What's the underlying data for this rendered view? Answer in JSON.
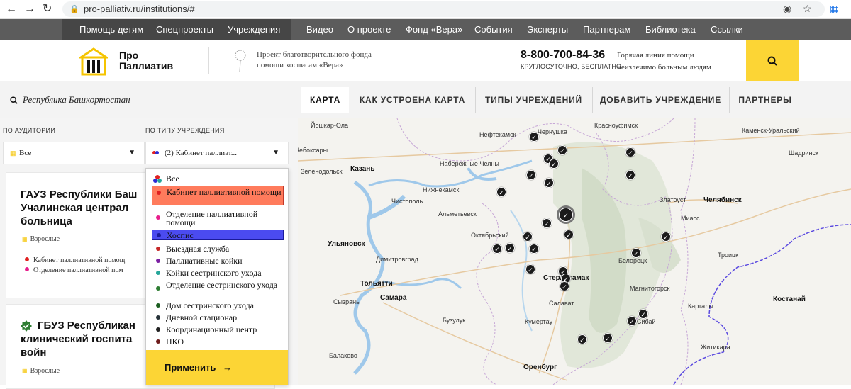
{
  "browser": {
    "url": "pro-palliativ.ru/institutions/#"
  },
  "topmenu": {
    "items": [
      "Помощь детям",
      "Спецпроекты",
      "Учреждения",
      "Видео",
      "О проекте",
      "Фонд «Вера»",
      "События",
      "Эксперты",
      "Партнерам",
      "Библиотека",
      "Ссылки"
    ]
  },
  "header": {
    "logo_line1": "Про",
    "logo_line2": "Паллиатив",
    "fund_line1": "Проект благотворительного фонда",
    "fund_line2": "помощи хосписам «Вера»",
    "phone": "8-800-700-84-36",
    "phone_sub": "КРУГЛОСУТОЧНО, БЕСПЛАТНО",
    "hotline_line1": "Горячая линия помощи",
    "hotline_line2": "неизлечимо больным людям"
  },
  "tabbar": {
    "region": "Республика Башкортостан",
    "tabs": [
      "КАРТА",
      "КАК УСТРОЕНА КАРТА",
      "ТИПЫ УЧРЕЖДЕНИЙ",
      "ДОБАВИТЬ УЧРЕЖДЕНИЕ",
      "ПАРТНЕРЫ"
    ]
  },
  "filters": {
    "audience_label": "ПО АУДИТОРИИ",
    "audience_value": "Все",
    "type_label": "ПО ТИПУ УЧРЕЖДЕНИЯ",
    "type_value": "(2) Кабинет паллиат..."
  },
  "cards": [
    {
      "title_lines": [
        "ГАУЗ Республики Баш",
        "Учалинская централ",
        "больница"
      ],
      "tag": "Взрослые",
      "items": [
        "Кабинет паллиативной помощ",
        "Отделение паллиативной пом"
      ]
    },
    {
      "title_lines": [
        "ГБУЗ Республикан",
        "клинический госпита",
        "войн"
      ],
      "tag": "Взрослые"
    }
  ],
  "dropdown": {
    "items": [
      {
        "label": "Все",
        "color": "#7b61ff"
      },
      {
        "label": "Кабинет паллиативной помощи",
        "color": "#e02020"
      },
      {
        "label": "Отделение паллиативной помощи",
        "color": "#e81e8c"
      },
      {
        "label": "Хоспис",
        "color": "#2b2bd6"
      },
      {
        "label": "Выездная служба",
        "color": "#c62828"
      },
      {
        "label": "Паллиативные койки",
        "color": "#7b1fa2"
      },
      {
        "label": "Койки сестринского ухода",
        "color": "#26a69a"
      },
      {
        "label": "Отделение сестринского ухода",
        "color": "#2e7d32"
      },
      {
        "label": "Дом сестринского ухода",
        "color": "#1b5e20"
      },
      {
        "label": "Дневной стационар",
        "color": "#263238"
      },
      {
        "label": "Координационный центр",
        "color": "#212121"
      },
      {
        "label": "НКО",
        "color": "#6d1b1b"
      }
    ],
    "apply_label": "Применить"
  },
  "map": {
    "cities": [
      "Йошкар-Ола",
      "Чебоксары",
      "Зеленодольск",
      "Казань",
      "Набережные Челны",
      "Нижнекамск",
      "Чистополь",
      "Альметьевск",
      "Октябрьский",
      "Ульяновск",
      "Димитровград",
      "Тольятти",
      "Самара",
      "Сызрань",
      "Бузулук",
      "Балаково",
      "Оренбург",
      "Кумертау",
      "Салават",
      "Стерлитамак",
      "Белорецк",
      "Магнитогорск",
      "Карталы",
      "Сибай",
      "Златоуст",
      "Миасс",
      "Челябинск",
      "Троицк",
      "Костанай",
      "Житикара",
      "Нефтекамск",
      "Чернушка",
      "Красноуфимск",
      "Каменск-Уральский",
      "Шадринск"
    ]
  },
  "colors": {
    "accent_yellow": "#fcd535",
    "menu_dark": "#464646",
    "menu": "#5c5c5c",
    "highlight_red": "#ff7b5c",
    "highlight_blue": "#4b4bf0"
  }
}
